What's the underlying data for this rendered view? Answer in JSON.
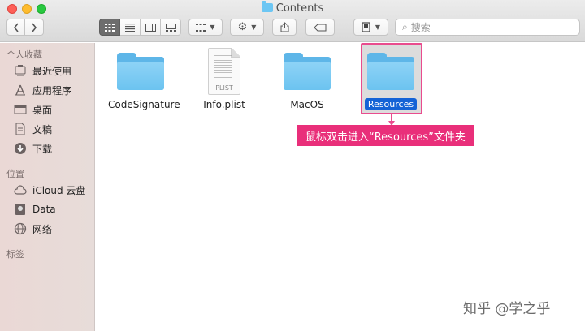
{
  "window": {
    "title": "Contents"
  },
  "toolbar": {
    "back_icon": "chevron-left-icon",
    "forward_icon": "chevron-right-icon",
    "view_modes": [
      {
        "icon": "icon-view-icon",
        "active": true
      },
      {
        "icon": "list-view-icon",
        "active": false
      },
      {
        "icon": "column-view-icon",
        "active": false
      },
      {
        "icon": "gallery-view-icon",
        "active": false
      }
    ],
    "group_icon": "group-by-icon",
    "action_icon": "gear-icon",
    "share_icon": "share-icon",
    "tag_icon": "tag-icon",
    "dropbox_icon": "dropbox-icon",
    "search_placeholder": "搜索"
  },
  "sidebar": {
    "favorites_heading": "个人收藏",
    "favorites": [
      {
        "label": "最近使用",
        "icon": "recents-icon"
      },
      {
        "label": "应用程序",
        "icon": "applications-icon"
      },
      {
        "label": "桌面",
        "icon": "desktop-icon"
      },
      {
        "label": "文稿",
        "icon": "documents-icon"
      },
      {
        "label": "下载",
        "icon": "downloads-icon"
      }
    ],
    "locations_heading": "位置",
    "locations": [
      {
        "label": "iCloud 云盘",
        "icon": "cloud-icon"
      },
      {
        "label": "Data",
        "icon": "disk-icon"
      },
      {
        "label": "网络",
        "icon": "network-icon"
      }
    ],
    "tags_heading": "标签"
  },
  "files": [
    {
      "name": "_CodeSignature",
      "kind": "folder",
      "selected": false
    },
    {
      "name": "Info.plist",
      "kind": "document",
      "ext": "PLIST",
      "selected": false
    },
    {
      "name": "MacOS",
      "kind": "folder",
      "selected": false
    },
    {
      "name": "Resources",
      "kind": "folder",
      "selected": true
    }
  ],
  "annotation": {
    "text": "鼠标双击进入“Resources”文件夹",
    "color": "#e92f7a"
  },
  "watermark": "知乎 @学之乎",
  "colors": {
    "selection": "#1463d6",
    "folder": "#6cc3f0"
  }
}
